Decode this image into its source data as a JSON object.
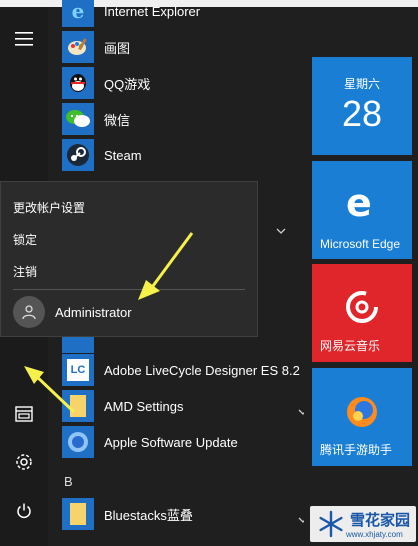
{
  "rail": {
    "menu_icon": "hamburger-icon",
    "documents_icon": "documents-icon",
    "settings_icon": "gear-icon",
    "power_icon": "power-icon"
  },
  "apps_top": [
    {
      "label": "Internet Explorer",
      "icon": "ie-icon"
    },
    {
      "label": "画图",
      "icon": "paint-icon"
    },
    {
      "label": "QQ游戏",
      "icon": "qq-game-icon"
    },
    {
      "label": "微信",
      "icon": "wechat-icon"
    },
    {
      "label": "Steam",
      "icon": "steam-icon"
    }
  ],
  "apps_bottom": [
    {
      "label": "Adobe LiveCycle Designer ES 8.2",
      "icon": "adobe-lc-icon",
      "badge": "LC"
    },
    {
      "label": "AMD Settings",
      "icon": "folder-icon"
    },
    {
      "label": "Apple Software Update",
      "icon": "apple-update-icon"
    }
  ],
  "section_b": "B",
  "bluestacks": {
    "label": "Bluestacks蓝叠",
    "icon": "folder-icon"
  },
  "flyout": {
    "change_account": "更改帐户设置",
    "lock": "锁定",
    "sign_out": "注销",
    "username": "Administrator"
  },
  "tiles": {
    "calendar": {
      "weekday": "星期六",
      "day": "28"
    },
    "edge": {
      "label": "Microsoft Edge"
    },
    "netease": {
      "label": "网易云音乐"
    },
    "tencent": {
      "label": "腾讯手游助手"
    }
  },
  "watermark": {
    "text": "雪花家园",
    "sub": "www.xhjaty.com"
  },
  "colors": {
    "tile_blue": "#1a7fd4",
    "tile_red": "#e0262a",
    "arrow": "#f5f04c"
  }
}
